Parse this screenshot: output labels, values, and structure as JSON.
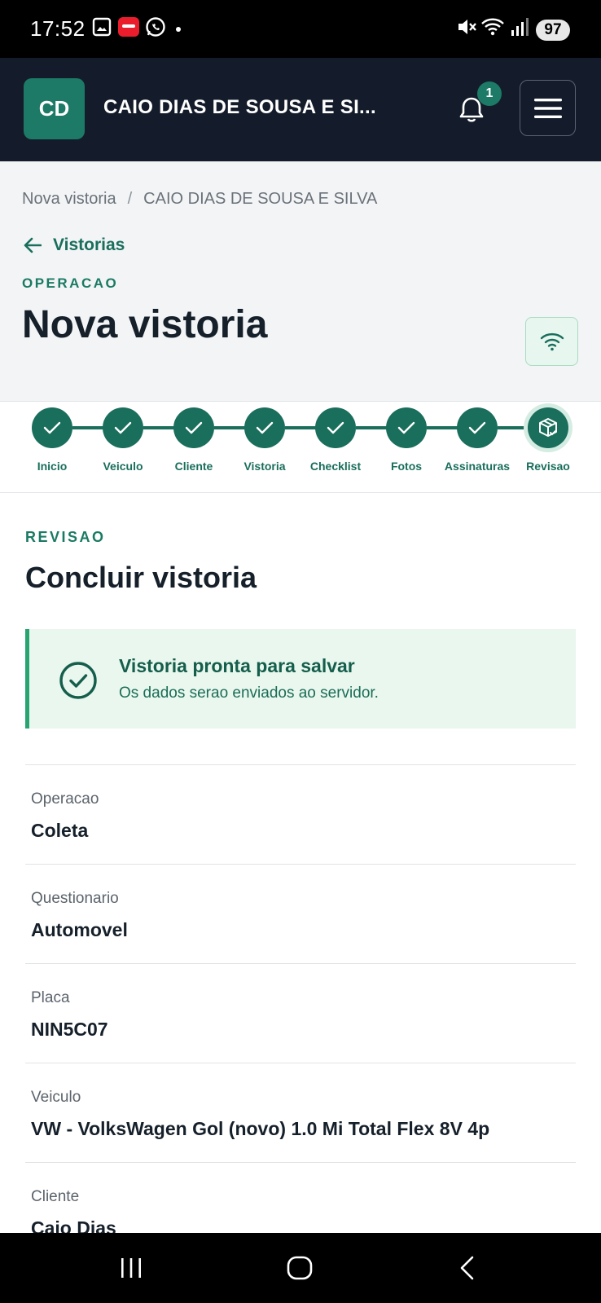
{
  "status_bar": {
    "time": "17:52",
    "battery": "97",
    "icons": [
      "gallery-icon",
      "ifood-icon",
      "whatsapp-icon",
      "notification-dot-icon",
      "mute-icon",
      "wifi-icon",
      "signal-icon",
      "battery-icon"
    ]
  },
  "header": {
    "avatar_initials": "CD",
    "user_name": "CAIO DIAS DE SOUSA E SI...",
    "notification_count": "1"
  },
  "breadcrumb": [
    "Nova vistoria",
    "/",
    "CAIO DIAS DE SOUSA E SILVA"
  ],
  "back_link": "Vistorias",
  "eyebrow": "OPERACAO",
  "page_title": "Nova vistoria",
  "stepper": {
    "steps": [
      {
        "label": "Inicio",
        "status": "done"
      },
      {
        "label": "Veiculo",
        "status": "done"
      },
      {
        "label": "Cliente",
        "status": "done"
      },
      {
        "label": "Vistoria",
        "status": "done"
      },
      {
        "label": "Checklist",
        "status": "done"
      },
      {
        "label": "Fotos",
        "status": "done"
      },
      {
        "label": "Assinaturas",
        "status": "done"
      },
      {
        "label": "Revisao",
        "status": "current"
      }
    ]
  },
  "section": {
    "eyebrow": "REVISAO",
    "title": "Concluir vistoria"
  },
  "alert": {
    "title": "Vistoria pronta para salvar",
    "message": "Os dados serao enviados ao servidor."
  },
  "summary": [
    {
      "label": "Operacao",
      "value": "Coleta"
    },
    {
      "label": "Questionario",
      "value": "Automovel"
    },
    {
      "label": "Placa",
      "value": "NIN5C07"
    },
    {
      "label": "Veiculo",
      "value": "VW - VolksWagen Gol (novo) 1.0 Mi Total Flex 8V 4p"
    },
    {
      "label": "Cliente",
      "value": "Caio Dias"
    }
  ],
  "colors": {
    "primary": "#1a6e5c",
    "header_bg": "#141c2b",
    "alert_bg": "#e9f7ef",
    "alert_border": "#27a46f"
  }
}
